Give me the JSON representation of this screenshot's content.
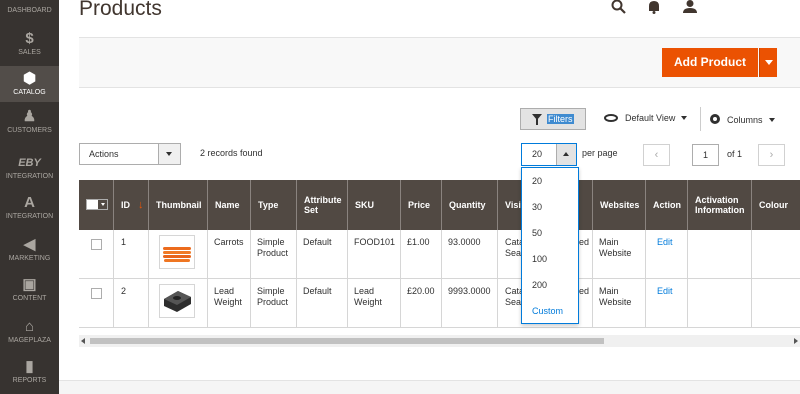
{
  "nav": [
    {
      "label": "DASHBOARD",
      "icon": "dashboard-icon",
      "glyph": "▦"
    },
    {
      "label": "SALES",
      "icon": "dollar-icon",
      "glyph": "$"
    },
    {
      "label": "CATALOG",
      "icon": "cube-icon",
      "glyph": "⬢"
    },
    {
      "label": "CUSTOMERS",
      "icon": "person-icon",
      "glyph": "♟"
    },
    {
      "label": "INTEGRATION",
      "icon": "ebay-icon",
      "glyph": "ebY"
    },
    {
      "label": "INTEGRATION",
      "icon": "amazon-icon",
      "glyph": "a"
    },
    {
      "label": "MARKETING",
      "icon": "megaphone-icon",
      "glyph": "◀"
    },
    {
      "label": "CONTENT",
      "icon": "content-icon",
      "glyph": "▣"
    },
    {
      "label": "MAGEPLAZA",
      "icon": "mageplaza-icon",
      "glyph": "⌂"
    },
    {
      "label": "REPORTS",
      "icon": "bar-chart-icon",
      "glyph": "▮"
    }
  ],
  "header": {
    "title": "Products"
  },
  "toolbar": {
    "add_label": "Add Product",
    "filters_label": "Filters",
    "default_view_label": "Default View",
    "columns_label": "Columns",
    "actions_label": "Actions",
    "records_found": "2 records found",
    "per_page_value": "20",
    "per_page_label": "per page",
    "prev_glyph": "‹",
    "next_glyph": "›",
    "page_current": "1",
    "page_of": "of 1"
  },
  "columns": {
    "id": "ID",
    "sort": "↓",
    "thumbnail": "Thumbnail",
    "name": "Name",
    "type": "Type",
    "attribute_set": "Attribute Set",
    "sku": "SKU",
    "price": "Price",
    "quantity": "Quantity",
    "visibility": "Visil",
    "websites": "Websites",
    "action": "Action",
    "activation": "Activation Information",
    "colour": "Colour"
  },
  "rows": [
    {
      "id": "1",
      "name": "Carrots",
      "type": "Simple Product",
      "attribute_set": "Default",
      "sku": "FOOD101",
      "price": "£1.00",
      "quantity": "93.0000",
      "visibility": "Cata Sear",
      "status_tail": "ed",
      "websites": "Main Website",
      "action": "Edit"
    },
    {
      "id": "2",
      "name": "Lead Weight",
      "type": "Simple Product",
      "attribute_set": "Default",
      "sku": "Lead Weight",
      "price": "£20.00",
      "quantity": "9993.0000",
      "visibility": "Cata Sear",
      "status_tail": "ed",
      "websites": "Main Website",
      "action": "Edit"
    }
  ],
  "per_page_options": [
    "20",
    "30",
    "50",
    "100",
    "200",
    "Custom"
  ],
  "colors": {
    "accent": "#eb5202",
    "header_bg": "#514943",
    "sidebar_bg": "#373330",
    "link": "#007bdb"
  }
}
